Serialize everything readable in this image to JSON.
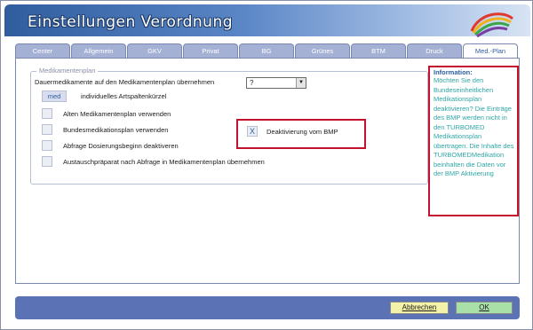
{
  "window": {
    "title": "Einstellungen Verordnung"
  },
  "tabs": [
    {
      "label": "Center"
    },
    {
      "label": "Allgemein"
    },
    {
      "label": "GKV"
    },
    {
      "label": "Privat"
    },
    {
      "label": "BG"
    },
    {
      "label": "Grünes"
    },
    {
      "label": "BTM"
    },
    {
      "label": "Druck"
    },
    {
      "label": "Med.-Plan"
    }
  ],
  "active_tab": "Med.-Plan",
  "medplan": {
    "group_title": "Medikamentenplan",
    "dauer_label": "Dauermedikamente auf den  Medikamentenplan übernehmen",
    "dauer_value": "?",
    "kuerzel_value": "med",
    "kuerzel_label": "individuelles Artspaltenkürzel",
    "options": [
      {
        "label": "Alten Medikamentenplan verwenden",
        "checked": false
      },
      {
        "label": "Bundesmedikationsplan verwenden",
        "checked": false
      },
      {
        "label": "Abfrage Dosierungsbeginn deaktiveren",
        "checked": false
      },
      {
        "label": "Austauschpräparat nach Abfrage in Medikamentenplan übernehmen",
        "checked": false
      }
    ],
    "bmp_mark": "X",
    "bmp_label": "Deaktivierung vom BMP",
    "bmp_checked": true
  },
  "info": {
    "title": "Information:",
    "text": "Möchten Sie den Bundeseinheitlichen Medikationsplan deaktivieren? Die Einträge des BMP werden nicht in den TURBOMED Medikationsplan übertragen. Die Inhalte des TURBOMEDMedikation beinhalten die Daten vor der BMP Aktivierung"
  },
  "buttons": {
    "cancel": "Abbrechen",
    "ok": "OK"
  },
  "colors": {
    "accent": "#2f5d9e",
    "highlight_frame": "#c4122e",
    "info_text": "#2fa6a6",
    "footer_bar": "#5b73b5",
    "cancel_button": "#f4f2a8",
    "ok_button": "#a8e0a8"
  }
}
